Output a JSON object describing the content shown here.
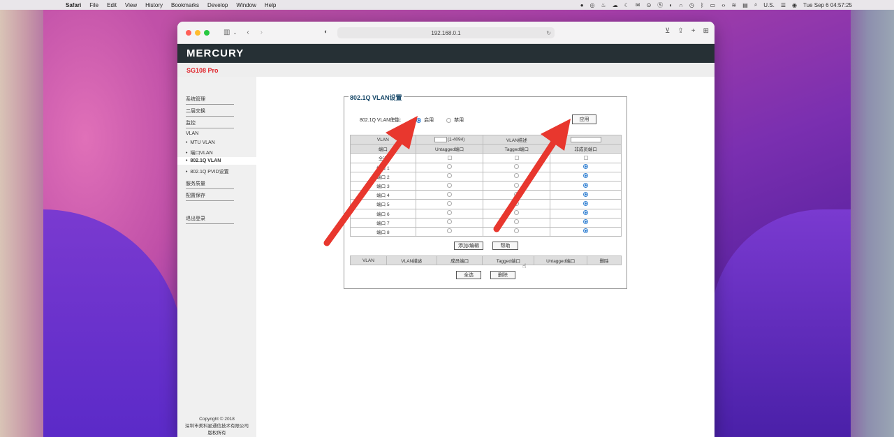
{
  "menubar": {
    "app": "Safari",
    "items": [
      "File",
      "Edit",
      "View",
      "History",
      "Bookmarks",
      "Develop",
      "Window",
      "Help"
    ],
    "input_source": "U.S.",
    "datetime": "Tue Sep 6  04:57:25"
  },
  "browser": {
    "url": "192.168.0.1"
  },
  "router": {
    "brand": "MERCURY",
    "model": "SG108 Pro",
    "nav": [
      "系统管理",
      "二层交换",
      "监控",
      "VLAN"
    ],
    "vlan_sub": [
      "MTU VLAN",
      "端口VLAN",
      "802.1Q VLAN",
      "802.1Q PVID设置"
    ],
    "nav_after": [
      "服务质量",
      "配置保存",
      "退出登录"
    ],
    "footer": [
      "Copyright © 2018",
      "深圳市美科星通信技术有限公司",
      "版权所有"
    ]
  },
  "panel": {
    "legend": "802.1Q VLAN设置",
    "enable_label": "802.1Q VLAN使能:",
    "enable_on": "启用",
    "enable_off": "禁用",
    "apply": "应用",
    "vlan_label": "VLAN",
    "vlan_range": "(1-4094)",
    "vlan_desc_label": "VLAN描述",
    "col_headers": [
      "端口",
      "Untagged端口",
      "Tagged端口",
      "非成员端口"
    ],
    "ports": [
      "端口 1",
      "端口 2",
      "端口 3",
      "端口 4",
      "端口 5",
      "端口 6",
      "端口 7",
      "端口 8"
    ],
    "select_all": "全选",
    "add_edit": "添加/编辑",
    "help": "帮助",
    "list_headers": [
      "VLAN",
      "VLAN描述",
      "成员端口",
      "Tagged端口",
      "Untagged端口",
      "删除"
    ],
    "delete": "删除"
  },
  "colors": {
    "brandbar": "#263035",
    "model_red": "#e0242b",
    "radio_blue": "#2f7fd2",
    "arrow_red": "#e8372e"
  }
}
